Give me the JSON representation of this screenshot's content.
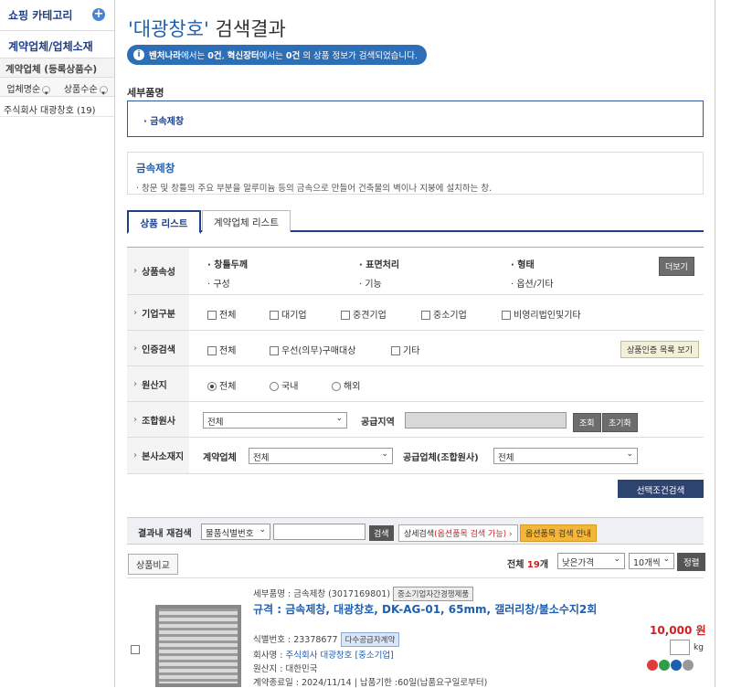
{
  "sidebar": {
    "category_title": "쇼핑 카테고리",
    "section_title": "계약업체/업체소재",
    "subsection": "계약업체 (등록상품수)",
    "sort_name": "업체명순",
    "sort_count": "상품수순",
    "items": [
      {
        "label": "주식회사 대광창호 (19)"
      }
    ]
  },
  "header": {
    "title_query": "'대광창호'",
    "title_suffix": " 검색결과"
  },
  "notice": {
    "venture": "벤처나라",
    "venture_suffix": "에서는 ",
    "venture_count": "0건",
    "innovation": "혁신장터",
    "innovation_suffix": "에서는 ",
    "innovation_count": "0건",
    "tail": " 의 상품 정보가 검색되었습니다."
  },
  "detail": {
    "label": "세부품명",
    "selected": "· 금속제창",
    "desc_title": "금속제창",
    "desc_text": "· 창문 및 창틀의 주요 부분을 알루미늄 등의 금속으로 만들어 건축물의 벽이나 지붕에 설치하는 창."
  },
  "tabs": [
    {
      "label": "상품 리스트"
    },
    {
      "label": "계약업체 리스트"
    }
  ],
  "filters": {
    "attr_label": "상품속성",
    "attrs": [
      "· 창틀두께",
      "· 표면처리",
      "· 형태",
      "· 구성",
      "· 기능",
      "· 옵션/기타"
    ],
    "more": "더보기",
    "company_label": "기업구분",
    "company_opts": [
      "전체",
      "대기업",
      "중견기업",
      "중소기업",
      "비영리법인및기타"
    ],
    "cert_label": "인증검색",
    "cert_opts": [
      "전체",
      "우선(의무)구매대상",
      "기타"
    ],
    "cert_btn": "상품인증 목록 보기",
    "origin_label": "원산지",
    "origin_opts": [
      "전체",
      "국내",
      "해외"
    ],
    "union_label": "조합원사",
    "union_value": "전체",
    "supply_region_label": "공급지역",
    "lookup": "조회",
    "reset": "초기화",
    "hq_label": "본사소재지",
    "contract_label": "계약업체",
    "contract_value": "전체",
    "supplier_label": "공급업체(조합원사)",
    "supplier_value": "전체",
    "apply": "선택조건검색"
  },
  "result_search": {
    "label": "결과내 재검색",
    "field": "물품식별번호",
    "search": "검색",
    "detail": "상세검색",
    "detail_red": "(옵션품목 검색 가능)",
    "detail_arrow": "›",
    "option_guide": "옵션품목 검색 안내"
  },
  "list_bar": {
    "compare": "상품비교",
    "total_prefix": "전체 ",
    "total_count": "19",
    "total_suffix": "개",
    "sort": "낮은가격",
    "per_page": "10개씩",
    "sort_btn": "정렬"
  },
  "product": {
    "category": "세부품명 : 금속제창 (3017169801)",
    "tag1": "중소기업자간경쟁제품",
    "title": "규격 : 금속제창, 대광창호, DK-AG-01, 65mm, 갤러리창/불소수지2회",
    "id": "식별번호 : 23378677",
    "tag2": "다수공급자계약",
    "company_prefix": "회사명 : ",
    "company": "주식회사 대광창호",
    "company_tag": "[중소기업]",
    "origin": "원산지 : 대한민국",
    "period": "계약종료일 : 2024/11/14 | 납품기한 :60일(납품요구일로부터)",
    "price": "10,000 원",
    "unit": "kg"
  }
}
